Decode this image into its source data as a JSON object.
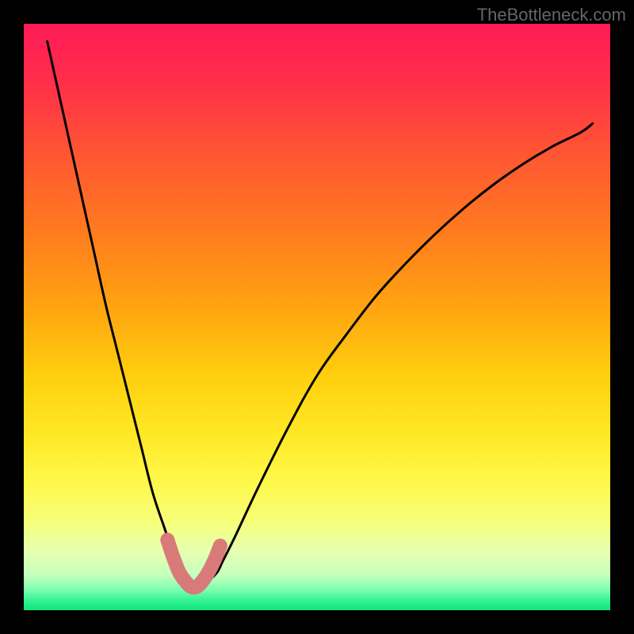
{
  "watermark": "TheBottleneck.com",
  "chart_data": {
    "type": "line",
    "title": "",
    "xlabel": "",
    "ylabel": "",
    "xlim": [
      0,
      100
    ],
    "ylim": [
      0,
      100
    ],
    "grid": false,
    "series": [
      {
        "name": "bottleneck-curve",
        "x_percent_from_left": [
          4,
          6,
          8,
          10,
          12,
          14,
          16,
          18,
          20,
          22,
          24,
          25,
          26,
          27,
          28,
          29,
          30,
          31.5,
          33,
          34,
          36,
          40,
          45,
          50,
          55,
          60,
          65,
          70,
          75,
          80,
          85,
          90,
          95,
          97
        ],
        "y_percent_from_top": [
          3,
          12,
          21,
          30,
          39,
          48,
          56,
          64,
          72,
          80,
          86,
          89,
          91.5,
          93.5,
          95,
          96,
          96,
          95,
          93.5,
          91.5,
          87.5,
          79,
          69,
          60,
          53,
          46.5,
          41,
          36,
          31.5,
          27.5,
          24,
          21,
          18.5,
          17
        ]
      },
      {
        "name": "highlight-band",
        "x_percent_from_left": [
          24.5,
          25.5,
          26.5,
          27.5,
          28.5,
          29.5,
          30.5,
          31.5,
          32.5,
          33.5
        ],
        "y_percent_from_top": [
          88,
          91,
          93.5,
          95,
          96,
          96,
          95,
          93.5,
          91.5,
          89
        ]
      }
    ],
    "note": "Percent coordinates are relative to the plot box (origin at top-left). Curve dips to ~96% depth near x≈29%."
  },
  "gradient_stops": [
    {
      "offset": 0.0,
      "color": "#ff1a56"
    },
    {
      "offset": 0.1,
      "color": "#ff2f49"
    },
    {
      "offset": 0.22,
      "color": "#ff5533"
    },
    {
      "offset": 0.35,
      "color": "#ff7a1f"
    },
    {
      "offset": 0.48,
      "color": "#ffa311"
    },
    {
      "offset": 0.6,
      "color": "#ffcf0e"
    },
    {
      "offset": 0.7,
      "color": "#ffe825"
    },
    {
      "offset": 0.78,
      "color": "#fff84a"
    },
    {
      "offset": 0.85,
      "color": "#f6ff7a"
    },
    {
      "offset": 0.9,
      "color": "#e6ffb0"
    },
    {
      "offset": 0.94,
      "color": "#c6ffbd"
    },
    {
      "offset": 0.965,
      "color": "#7dffb0"
    },
    {
      "offset": 0.985,
      "color": "#2df28f"
    },
    {
      "offset": 1.0,
      "color": "#14e37a"
    }
  ],
  "highlight_color": "#d97a7a"
}
